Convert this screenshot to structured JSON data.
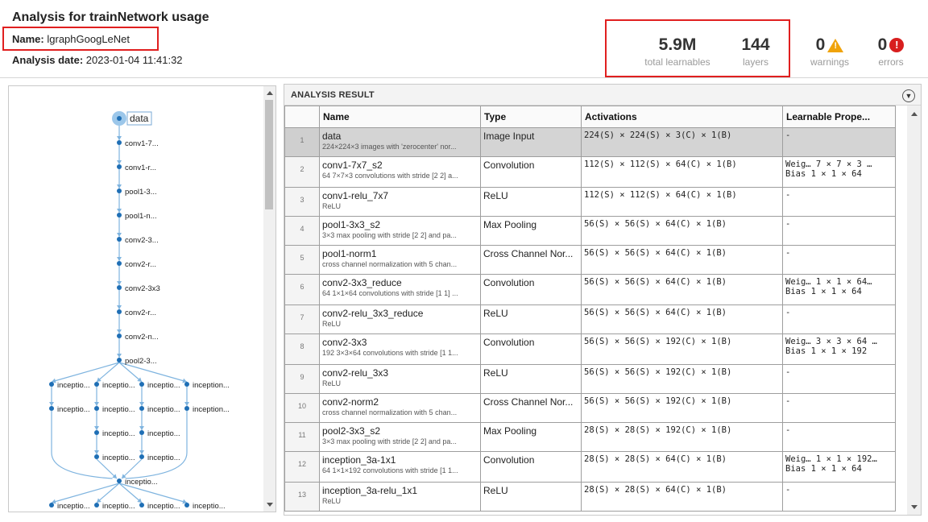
{
  "header": {
    "title": "Analysis for trainNetwork usage",
    "name_label": "Name:",
    "name_value": "lgraphGoogLeNet",
    "date_label": "Analysis date:",
    "date_value": "2023-01-04 11:41:32"
  },
  "summary": {
    "learnables_value": "5.9M",
    "learnables_caption": "total learnables",
    "layers_value": "144",
    "layers_caption": "layers",
    "warnings_value": "0",
    "warnings_caption": "warnings",
    "errors_value": "0",
    "errors_caption": "errors",
    "warning_color": "#f0a30a",
    "error_color": "#d81e1e",
    "highlight_color": "#e01f1f"
  },
  "graph": {
    "chain_nodes": [
      "data",
      "conv1-7...",
      "conv1-r...",
      "pool1-3...",
      "pool1-n...",
      "conv2-3...",
      "conv2-r...",
      "conv2-3x3",
      "conv2-r...",
      "conv2-n...",
      "pool2-3..."
    ],
    "branch_row1": [
      "inceptio...",
      "inceptio...",
      "inceptio...",
      "inception..."
    ],
    "branch_row2": [
      "inceptio...",
      "inceptio...",
      "inceptio...",
      "inception..."
    ],
    "branch_row3": [
      "inceptio...",
      "inceptio..."
    ],
    "branch_row4": [
      "inceptio...",
      "inceptio..."
    ],
    "concat_node": "inceptio...",
    "branch_row5": [
      "inceptio...",
      "inceptio...",
      "inceptio...",
      "inceptio..."
    ],
    "node_color": "#1f6fb5",
    "edge_color": "#7fb4df"
  },
  "result": {
    "title": "ANALYSIS RESULT",
    "columns": [
      "Name",
      "Type",
      "Activations",
      "Learnable Prope..."
    ],
    "rows": [
      {
        "idx": "1",
        "name": "data",
        "desc": "224×224×3 images with 'zerocenter' nor...",
        "type": "Image Input",
        "act": "224(S) × 224(S) × 3(C) × 1(B)",
        "learn1": "-",
        "learn2": ""
      },
      {
        "idx": "2",
        "name": "conv1-7x7_s2",
        "desc": "64 7×7×3 convolutions with stride [2 2] a...",
        "type": "Convolution",
        "act": "112(S) × 112(S) × 64(C) × 1(B)",
        "learn1": "Weig…  7 × 7 × 3 …",
        "learn2": "Bias   1 × 1 × 64"
      },
      {
        "idx": "3",
        "name": "conv1-relu_7x7",
        "desc": "ReLU",
        "type": "ReLU",
        "act": "112(S) × 112(S) × 64(C) × 1(B)",
        "learn1": "-",
        "learn2": ""
      },
      {
        "idx": "4",
        "name": "pool1-3x3_s2",
        "desc": "3×3 max pooling with stride [2 2] and pa...",
        "type": "Max Pooling",
        "act": "56(S) × 56(S) × 64(C) × 1(B)",
        "learn1": "-",
        "learn2": ""
      },
      {
        "idx": "5",
        "name": "pool1-norm1",
        "desc": "cross channel normalization with 5 chan...",
        "type": "Cross Channel Nor...",
        "act": "56(S) × 56(S) × 64(C) × 1(B)",
        "learn1": "-",
        "learn2": ""
      },
      {
        "idx": "6",
        "name": "conv2-3x3_reduce",
        "desc": "64 1×1×64 convolutions with stride [1 1] ...",
        "type": "Convolution",
        "act": "56(S) × 56(S) × 64(C) × 1(B)",
        "learn1": "Weig…  1 × 1 × 64…",
        "learn2": "Bias   1 × 1 × 64"
      },
      {
        "idx": "7",
        "name": "conv2-relu_3x3_reduce",
        "desc": "ReLU",
        "type": "ReLU",
        "act": "56(S) × 56(S) × 64(C) × 1(B)",
        "learn1": "-",
        "learn2": ""
      },
      {
        "idx": "8",
        "name": "conv2-3x3",
        "desc": "192 3×3×64 convolutions with stride [1 1...",
        "type": "Convolution",
        "act": "56(S) × 56(S) × 192(C) × 1(B)",
        "learn1": "Weig…  3 × 3 × 64 …",
        "learn2": "Bias   1 × 1 × 192"
      },
      {
        "idx": "9",
        "name": "conv2-relu_3x3",
        "desc": "ReLU",
        "type": "ReLU",
        "act": "56(S) × 56(S) × 192(C) × 1(B)",
        "learn1": "-",
        "learn2": ""
      },
      {
        "idx": "10",
        "name": "conv2-norm2",
        "desc": "cross channel normalization with 5 chan...",
        "type": "Cross Channel Nor...",
        "act": "56(S) × 56(S) × 192(C) × 1(B)",
        "learn1": "-",
        "learn2": ""
      },
      {
        "idx": "11",
        "name": "pool2-3x3_s2",
        "desc": "3×3 max pooling with stride [2 2] and pa...",
        "type": "Max Pooling",
        "act": "28(S) × 28(S) × 192(C) × 1(B)",
        "learn1": "-",
        "learn2": ""
      },
      {
        "idx": "12",
        "name": "inception_3a-1x1",
        "desc": "64 1×1×192 convolutions with stride [1 1...",
        "type": "Convolution",
        "act": "28(S) × 28(S) × 64(C) × 1(B)",
        "learn1": "Weig…  1 × 1 × 192…",
        "learn2": "Bias   1 × 1 × 64"
      },
      {
        "idx": "13",
        "name": "inception_3a-relu_1x1",
        "desc": "ReLU",
        "type": "ReLU",
        "act": "28(S) × 28(S) × 64(C) × 1(B)",
        "learn1": "-",
        "learn2": ""
      }
    ]
  }
}
